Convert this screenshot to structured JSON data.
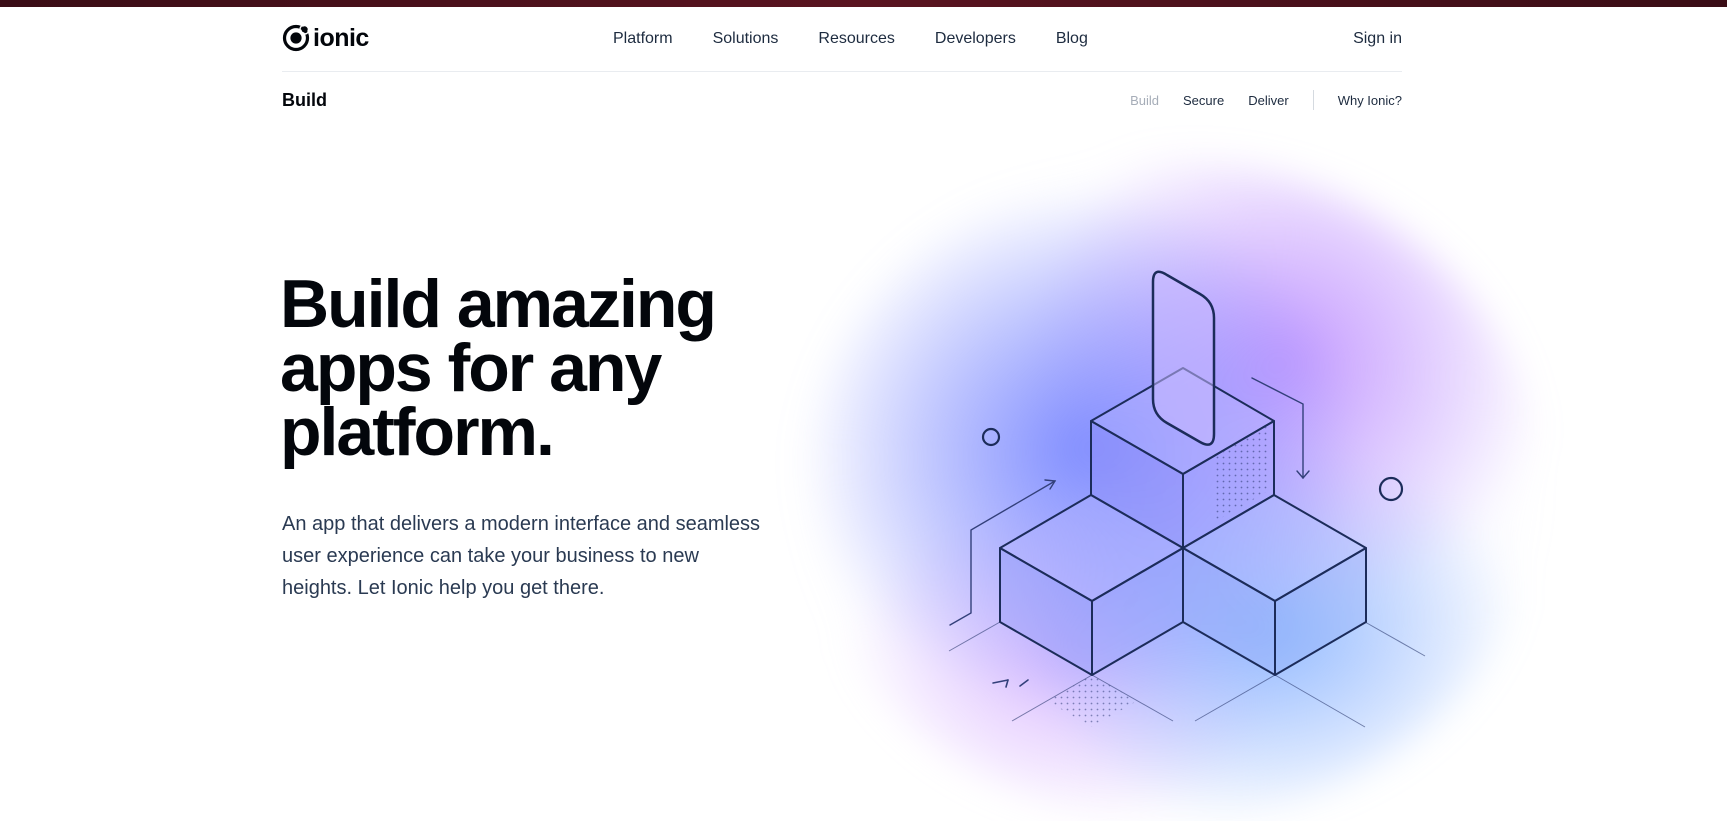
{
  "brand": {
    "name": "ionic"
  },
  "nav": {
    "items": [
      {
        "label": "Platform"
      },
      {
        "label": "Solutions"
      },
      {
        "label": "Resources"
      },
      {
        "label": "Developers"
      },
      {
        "label": "Blog"
      }
    ],
    "signin_label": "Sign in"
  },
  "subnav": {
    "title": "Build",
    "links": [
      {
        "label": "Build",
        "active": true
      },
      {
        "label": "Secure"
      },
      {
        "label": "Deliver"
      }
    ],
    "why_label": "Why Ionic?"
  },
  "hero": {
    "title": "Build amazing apps for any platform.",
    "description": "An app that delivers a modern interface and seamless user experience can take your business to new heights. Let Ionic help you get there."
  },
  "colors": {
    "top_strip": "#4a1019",
    "text_dark": "#03060b",
    "text_muted": "#a6adb8",
    "line_navy": "#1c2c5a"
  },
  "icons": {
    "logo": "ionic-logo-icon"
  }
}
